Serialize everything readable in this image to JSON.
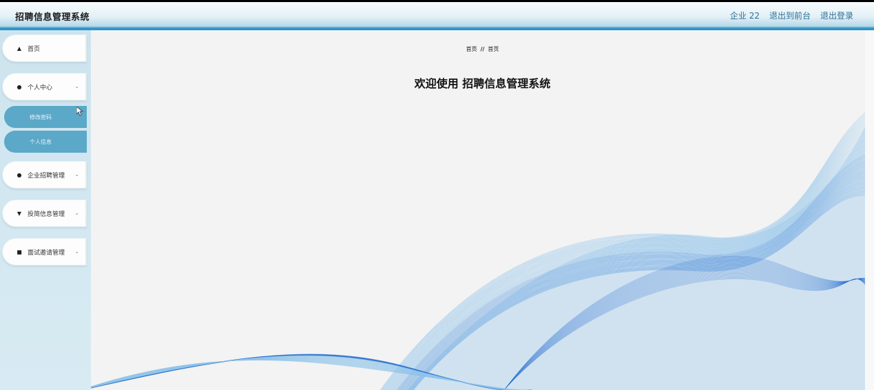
{
  "header": {
    "app_title": "招聘信息管理系统",
    "user": "企业 22",
    "back_front": "退出到前台",
    "logout": "退出登录"
  },
  "sidebar": {
    "items": [
      {
        "label": "首页",
        "icon": "home-icon"
      },
      {
        "label": "个人中心",
        "icon": "user-icon"
      },
      {
        "label": "企业招聘管理",
        "icon": "user-icon"
      },
      {
        "label": "投简信息管理",
        "icon": "pin-icon"
      },
      {
        "label": "面试邀请管理",
        "icon": "ticket-icon"
      }
    ],
    "sub_items": [
      {
        "label": "修改密码"
      },
      {
        "label": "个人信息"
      }
    ]
  },
  "main": {
    "breadcrumb_home": "首页",
    "breadcrumb_sep": "//",
    "breadcrumb_current": "首页",
    "welcome": "欢迎使用 招聘信息管理系统"
  },
  "colors": {
    "accent": "#2f95c6",
    "sub_item_bg": "#5ba8c8",
    "wave_light": "#8ec3ea",
    "wave_dark": "#2a6fd1"
  }
}
